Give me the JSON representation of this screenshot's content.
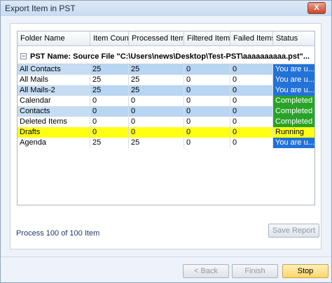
{
  "window": {
    "title": "Export Item in PST",
    "close_label": "X"
  },
  "grid": {
    "columns": [
      "Folder Name",
      "Item Count",
      "Processed Items",
      "Filtered Items",
      "Failed Items",
      "Status"
    ],
    "group": {
      "expander": "−",
      "text": "PST Name: Source File \"C:\\Users\\news\\Desktop\\Test-PST\\aaaaaaaaaa.pst\"..."
    },
    "rows": [
      {
        "name": "All Contacts",
        "count": "25",
        "processed": "25",
        "filtered": "0",
        "failed": "0",
        "status": "You are u...",
        "status_type": "blue",
        "style": "blue"
      },
      {
        "name": "All Mails",
        "count": "25",
        "processed": "25",
        "filtered": "0",
        "failed": "0",
        "status": "You are u...",
        "status_type": "blue",
        "style": "plain"
      },
      {
        "name": "All Mails-2",
        "count": "25",
        "processed": "25",
        "filtered": "0",
        "failed": "0",
        "status": "You are u...",
        "status_type": "blue",
        "style": "blue"
      },
      {
        "name": "Calendar",
        "count": "0",
        "processed": "0",
        "filtered": "0",
        "failed": "0",
        "status": "Completed",
        "status_type": "complete",
        "style": "plain"
      },
      {
        "name": "Contacts",
        "count": "0",
        "processed": "0",
        "filtered": "0",
        "failed": "0",
        "status": "Completed",
        "status_type": "complete",
        "style": "blue"
      },
      {
        "name": "Deleted Items",
        "count": "0",
        "processed": "0",
        "filtered": "0",
        "failed": "0",
        "status": "Completed",
        "status_type": "complete",
        "style": "plain"
      },
      {
        "name": "Drafts",
        "count": "0",
        "processed": "0",
        "filtered": "0",
        "failed": "0",
        "status": "Running",
        "status_type": "running",
        "style": "running"
      },
      {
        "name": "Agenda",
        "count": "25",
        "processed": "25",
        "filtered": "0",
        "failed": "0",
        "status": "You are u...",
        "status_type": "blue",
        "style": "plain"
      }
    ]
  },
  "progress": {
    "text": "Process 100 of 100 Item"
  },
  "buttons": {
    "save_report": "Save Report",
    "back": "< Back",
    "finish": "Finish",
    "stop": "Stop"
  },
  "colors": {
    "completed": "#28a328",
    "trial": "#2272d8",
    "running": "#ffff14",
    "selected_row": "#b8d5f2"
  }
}
